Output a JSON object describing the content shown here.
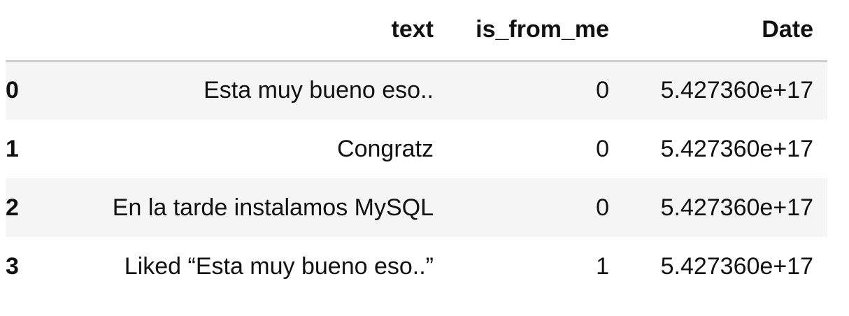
{
  "table": {
    "columns": [
      "text",
      "is_from_me",
      "Date"
    ],
    "rows": [
      {
        "index": "0",
        "text": "Esta muy bueno eso..",
        "is_from_me": "0",
        "date": "5.427360e+17"
      },
      {
        "index": "1",
        "text": "Congratz",
        "is_from_me": "0",
        "date": "5.427360e+17"
      },
      {
        "index": "2",
        "text": "En la tarde instalamos MySQL",
        "is_from_me": "0",
        "date": "5.427360e+17"
      },
      {
        "index": "3",
        "text": "Liked “Esta muy bueno eso..”",
        "is_from_me": "1",
        "date": "5.427360e+17"
      }
    ]
  }
}
